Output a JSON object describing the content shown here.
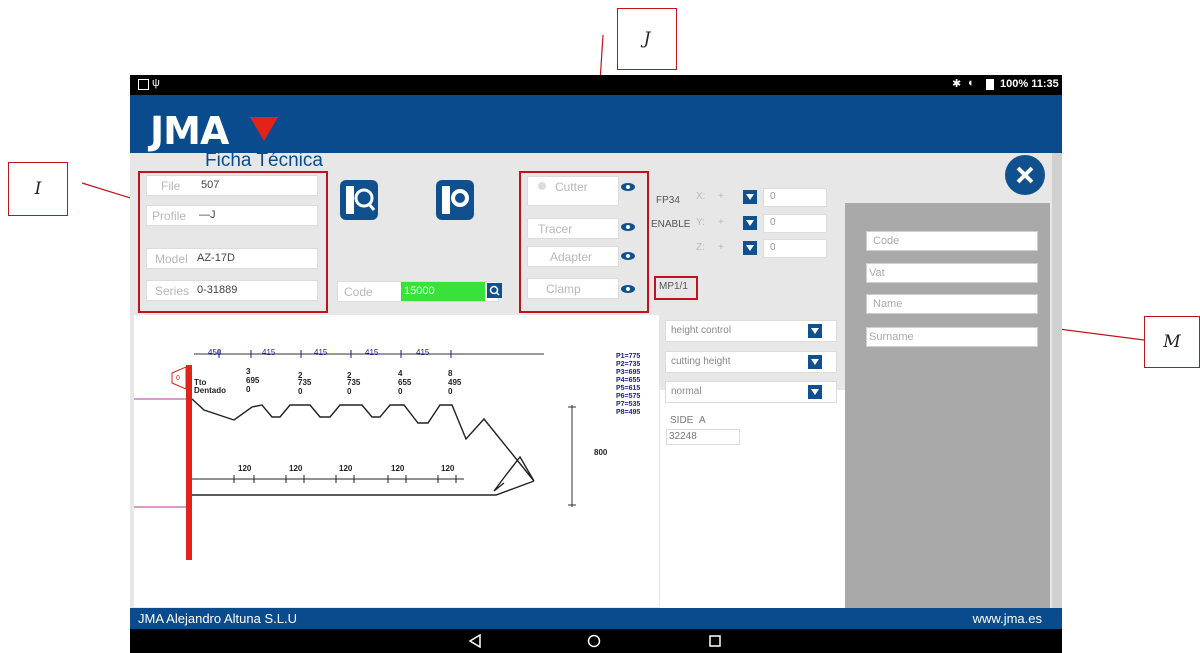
{
  "callouts": {
    "I": "I",
    "J": "J",
    "M": "M"
  },
  "statusbar": {
    "right_text": "100% 11:35"
  },
  "header": {
    "brand": "JMA"
  },
  "page": {
    "title": "Ficha Técnica"
  },
  "left_fields": {
    "file": {
      "label": "File",
      "value": "507"
    },
    "profile": {
      "label": "Profile",
      "value": "—J"
    },
    "model": {
      "label": "Model",
      "value": "AZ-17D"
    },
    "series": {
      "label": "Series",
      "value": "0-31889"
    }
  },
  "code_search": {
    "label": "Code",
    "value": "15000"
  },
  "tools": {
    "cutter": "Cutter",
    "tracer": "Tracer",
    "adapter": "Adapter",
    "clamp": "Clamp"
  },
  "axes": {
    "fp_label": "FP34",
    "enable_label": "ENABLE",
    "x": {
      "label": "X:",
      "sign": "+",
      "value": "0"
    },
    "y": {
      "label": "Y:",
      "sign": "+",
      "value": "0"
    },
    "z": {
      "label": "Z:",
      "sign": "+",
      "value": "0"
    }
  },
  "mp_label": "MP1/1",
  "dropdowns": {
    "height_control": "height control",
    "cutting_height": "cutting height",
    "mode": "normal"
  },
  "side": {
    "label": "SIDE",
    "value": "A",
    "number": "32248"
  },
  "customer": {
    "code_placeholder": "Code",
    "vat_placeholder": "Vat",
    "name_placeholder": "Name",
    "surname_placeholder": "Surname"
  },
  "drawing": {
    "top_dims": [
      "450",
      "415",
      "415",
      "415",
      "415"
    ],
    "depths": [
      "3",
      "2",
      "2",
      "4",
      "8"
    ],
    "depth_vals": [
      "695",
      "735",
      "735",
      "655",
      "495"
    ],
    "zeros": [
      "0",
      "0",
      "0",
      "0",
      "0"
    ],
    "tope_label_1": "Tto",
    "tope_label_2": "Dentado",
    "zero_mark": "0",
    "bottom_dims": [
      "120",
      "120",
      "120",
      "120",
      "120"
    ],
    "right_dim": "800",
    "p_list": [
      "P1=775",
      "P2=735",
      "P3=695",
      "P4=655",
      "P5=615",
      "P6=575",
      "P7=535",
      "P8=495"
    ]
  },
  "footer": {
    "left": "JMA Alejandro Altuna S.L.U",
    "right": "www.jma.es"
  },
  "colors": {
    "header_blue": "#0a4b8e",
    "accent_green": "#39e23b",
    "highlight_red": "#c0141c"
  }
}
